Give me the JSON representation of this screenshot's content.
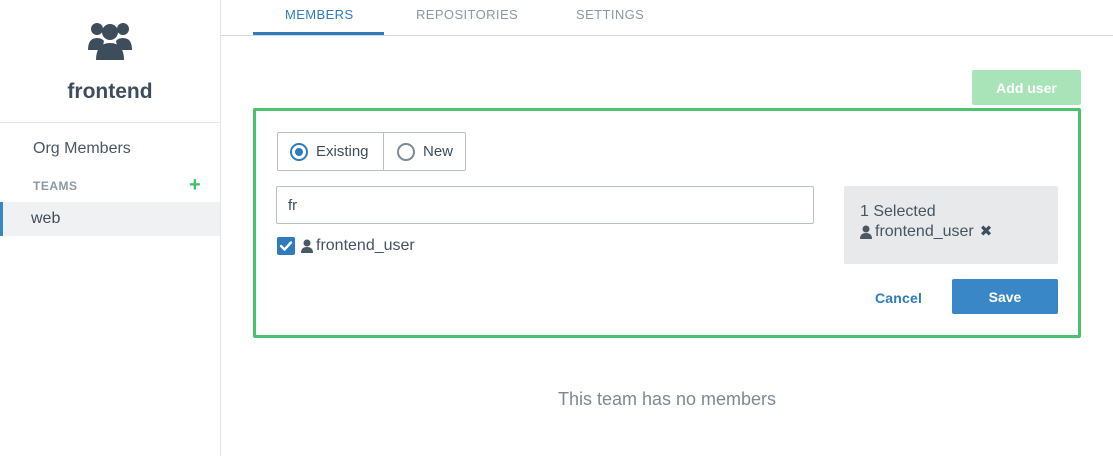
{
  "team": {
    "name": "frontend"
  },
  "sidebar": {
    "org_members": "Org Members",
    "teams_label": "TEAMS",
    "add_team_symbol": "+",
    "teams": [
      {
        "label": "web"
      }
    ]
  },
  "tabs": [
    {
      "label": "MEMBERS"
    },
    {
      "label": "REPOSITORIES"
    },
    {
      "label": "SETTINGS"
    }
  ],
  "add_user_label": "Add user",
  "panel": {
    "mode_existing": "Existing",
    "mode_new": "New",
    "search_value": "fr",
    "result_user": "frontend_user",
    "selected_count": "1 Selected",
    "selected_user": "frontend_user",
    "remove_symbol": "✖",
    "cancel_label": "Cancel",
    "save_label": "Save"
  },
  "empty_message": "This team has no members",
  "colors": {
    "accent": "#2f7bbd",
    "success": "#4cc26f",
    "add_user_disabled": "#a8e4b8"
  },
  "icons": {
    "team": "users-icon",
    "user": "user-icon",
    "check": "check-icon",
    "remove": "close-icon"
  }
}
